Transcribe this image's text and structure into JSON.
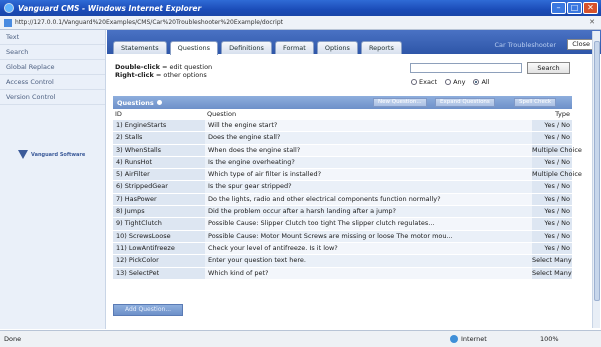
{
  "window": {
    "title": "Vanguard CMS - Windows Internet Explorer",
    "address": "http://127.0.0.1/Vanguard%20Examples/CMS/Car%20Troubleshooter%20Example/docript"
  },
  "sidebar": {
    "items": [
      {
        "label": "Text"
      },
      {
        "label": "Search"
      },
      {
        "label": "Global Replace"
      },
      {
        "label": "Access Control"
      },
      {
        "label": "Version Control"
      }
    ],
    "logo_text": "Vanguard Software"
  },
  "tabs": [
    {
      "label": "Statements",
      "active": false
    },
    {
      "label": "Questions",
      "active": true
    },
    {
      "label": "Definitions",
      "active": false
    },
    {
      "label": "Format",
      "active": false
    },
    {
      "label": "Options",
      "active": false
    },
    {
      "label": "Reports",
      "active": false
    }
  ],
  "header": {
    "app_name": "Car Troubleshooter",
    "close_label": "Close"
  },
  "hint": {
    "dbl_key": "Double-click",
    "dbl_text": " = edit question",
    "right_key": "Right-click",
    "right_text": " = other options"
  },
  "search": {
    "button_label": "Search",
    "value": "",
    "options": [
      {
        "label": "Exact",
        "selected": false
      },
      {
        "label": "Any",
        "selected": false
      },
      {
        "label": "All",
        "selected": true
      }
    ]
  },
  "questions": {
    "panel_title": "Questions",
    "buttons": {
      "new": "New Question...",
      "expand": "Expand Questions",
      "spell": "Spell Check"
    },
    "columns": {
      "id": "ID",
      "question": "Question",
      "type": "Type"
    },
    "rows": [
      {
        "id": "1)  EngineStarts",
        "question": "Will the engine start?",
        "type": "Yes / No"
      },
      {
        "id": "2)  Stalls",
        "question": "Does the engine stall?",
        "type": "Yes / No"
      },
      {
        "id": "3)  WhenStalls",
        "question": "When does the engine stall?",
        "type": "Multiple Choice"
      },
      {
        "id": "4)  RunsHot",
        "question": "Is the engine overheating?",
        "type": "Yes / No"
      },
      {
        "id": "5)  AirFilter",
        "question": "Which type of air filter is installed?",
        "type": "Multiple Choice"
      },
      {
        "id": "6)  StrippedGear",
        "question": "Is the spur gear stripped?",
        "type": "Yes / No"
      },
      {
        "id": "7)  HasPower",
        "question": "Do the lights, radio and other electrical components function normally?",
        "type": "Yes / No"
      },
      {
        "id": "8)  Jumps",
        "question": "Did the problem occur after a harsh landing after a jump?",
        "type": "Yes / No"
      },
      {
        "id": "9)  TightClutch",
        "question": "Possible Cause:  Slipper Clutch too tight The slipper clutch regulates...",
        "type": "Yes / No"
      },
      {
        "id": "10)  ScrewsLoose",
        "question": "Possible Cause:  Motor Mount Screws are missing or loose The motor mou...",
        "type": "Yes / No"
      },
      {
        "id": "11)  LowAntifreeze",
        "question": "Check your level of antifreeze. Is it low?",
        "type": "Yes / No"
      },
      {
        "id": "12)  PickColor",
        "question": "Enter your question text here.",
        "type": "Select Many"
      },
      {
        "id": "13)  SelectPet",
        "question": "Which kind of pet?",
        "type": "Select Many"
      }
    ],
    "add_label": "Add Question..."
  },
  "status": {
    "left": "Done",
    "zone": "Internet",
    "zoom": "100%"
  }
}
